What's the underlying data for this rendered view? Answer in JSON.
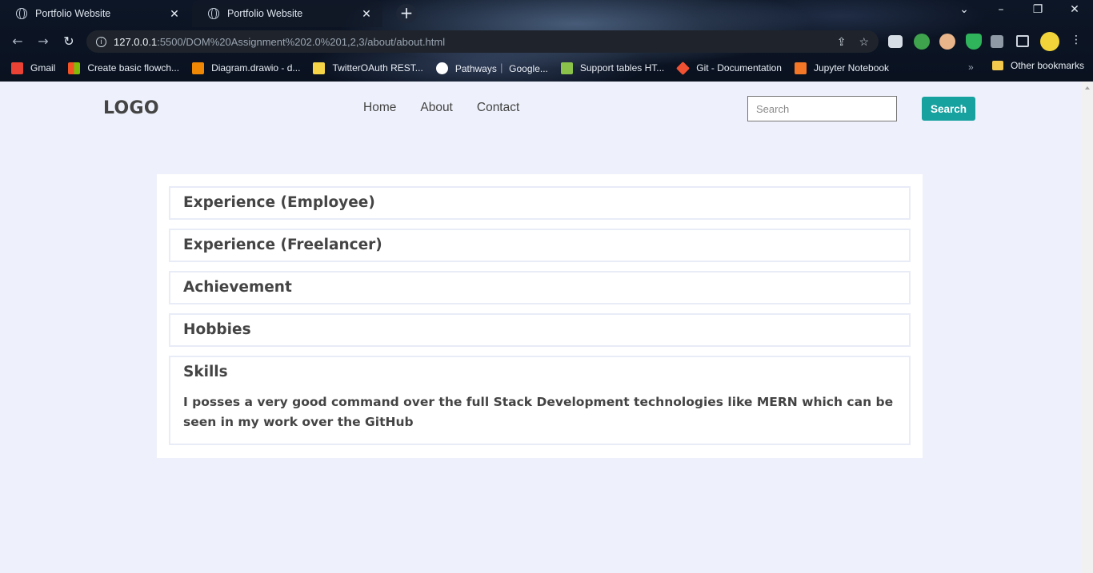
{
  "browser": {
    "tabs": [
      {
        "title": "Portfolio Website",
        "active": false
      },
      {
        "title": "Portfolio Website",
        "active": true
      }
    ],
    "new_tab_label": "+",
    "window_controls": {
      "minimize": "–",
      "restore": "❐",
      "close": "✕"
    },
    "url": {
      "host": "127.0.0.1",
      "path": ":5500/DOM%20Assignment%202.0%201,2,3/about/about.html"
    },
    "bookmarks": [
      {
        "label": "Gmail",
        "icon": "gmail-icon",
        "color": "#ea4335"
      },
      {
        "label": "Create basic flowch...",
        "icon": "microsoft-icon",
        "color": "#f35325"
      },
      {
        "label": "Diagram.drawio - d...",
        "icon": "drawio-icon",
        "color": "#f08705"
      },
      {
        "label": "TwitterOAuth REST...",
        "icon": "qr-icon",
        "color": "#f5d547"
      },
      {
        "label": "Pathways｜ Google...",
        "icon": "google-dev-icon",
        "color": "#ffffff"
      },
      {
        "label": "Support tables HT...",
        "icon": "caniuse-icon",
        "color": "#8bc34a"
      },
      {
        "label": "Git - Documentation",
        "icon": "git-icon",
        "color": "#f05133"
      },
      {
        "label": "Jupyter Notebook",
        "icon": "jupyter-icon",
        "color": "#f37726"
      }
    ],
    "bookmarks_more": "»",
    "other_bookmarks": "Other bookmarks"
  },
  "header": {
    "logo": "LOGO",
    "nav": [
      "Home",
      "About",
      "Contact"
    ],
    "search_placeholder": "Search",
    "search_button": "Search",
    "accent_color": "#17a2a0"
  },
  "sections": [
    {
      "title": "Experience (Employee)",
      "content": ""
    },
    {
      "title": "Experience (Freelancer)",
      "content": ""
    },
    {
      "title": "Achievement",
      "content": ""
    },
    {
      "title": "Hobbies",
      "content": ""
    },
    {
      "title": "Skills",
      "content": "I posses a very good command over the full Stack Development technologies like MERN which can be seen in my work over the GitHub"
    }
  ]
}
